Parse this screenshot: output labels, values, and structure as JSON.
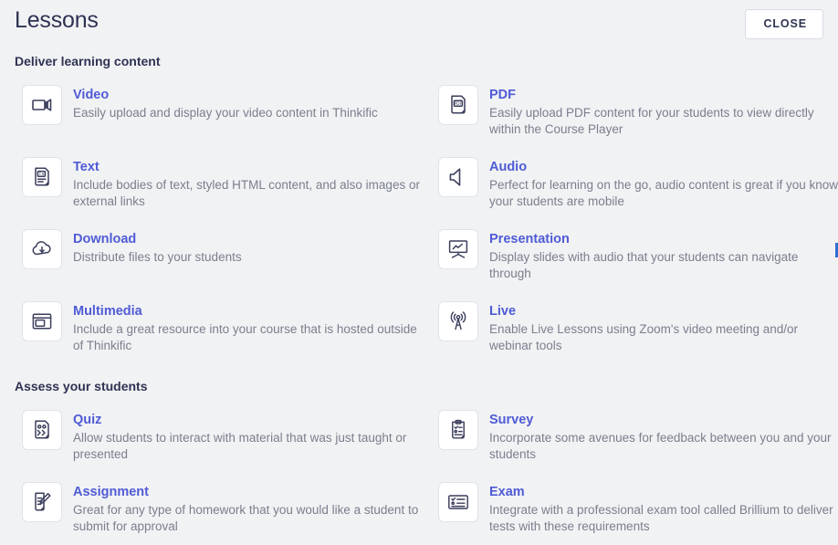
{
  "header": {
    "title": "Lessons",
    "close_label": "CLOSE"
  },
  "colors": {
    "background": "#f1f2f4",
    "title_text": "#2f3352",
    "link": "#4f5bd5",
    "description_text": "#7a7f8c",
    "tile_border": "#dfe3e8",
    "tile_background": "#ffffff",
    "scroll_indicator": "#2f6fd0"
  },
  "sections": [
    {
      "heading": "Deliver learning content",
      "cards": [
        {
          "icon": "video-camera-icon",
          "title": "Video",
          "description": "Easily upload and display your video content in Thinkific"
        },
        {
          "icon": "pdf-document-icon",
          "title": "PDF",
          "description": "Easily upload PDF content for your students to view directly within the Course Player"
        },
        {
          "icon": "text-document-icon",
          "title": "Text",
          "description": "Include bodies of text, styled HTML content, and also images or external links"
        },
        {
          "icon": "audio-speaker-icon",
          "title": "Audio",
          "description": "Perfect for learning on the go, audio content is great if you know your students are mobile"
        },
        {
          "icon": "cloud-download-icon",
          "title": "Download",
          "description": "Distribute files to your students"
        },
        {
          "icon": "presentation-screen-icon",
          "title": "Presentation",
          "description": "Display slides with audio that your students can navigate through"
        },
        {
          "icon": "multimedia-window-icon",
          "title": "Multimedia",
          "description": "Include a great resource into your course that is hosted outside of Thinkific"
        },
        {
          "icon": "live-broadcast-icon",
          "title": "Live",
          "description": "Enable Live Lessons using Zoom's video meeting and/or webinar tools"
        }
      ]
    },
    {
      "heading": "Assess your students",
      "cards": [
        {
          "icon": "quiz-document-icon",
          "title": "Quiz",
          "description": "Allow students to interact with material that was just taught or presented"
        },
        {
          "icon": "survey-clipboard-icon",
          "title": "Survey",
          "description": "Incorporate some avenues for feedback between you and your students"
        },
        {
          "icon": "assignment-pencil-icon",
          "title": "Assignment",
          "description": "Great for any type of homework that you would like a student to submit for approval"
        },
        {
          "icon": "exam-checklist-icon",
          "title": "Exam",
          "description": "Integrate with a professional exam tool called Brillium to deliver tests with these requirements"
        }
      ]
    }
  ]
}
